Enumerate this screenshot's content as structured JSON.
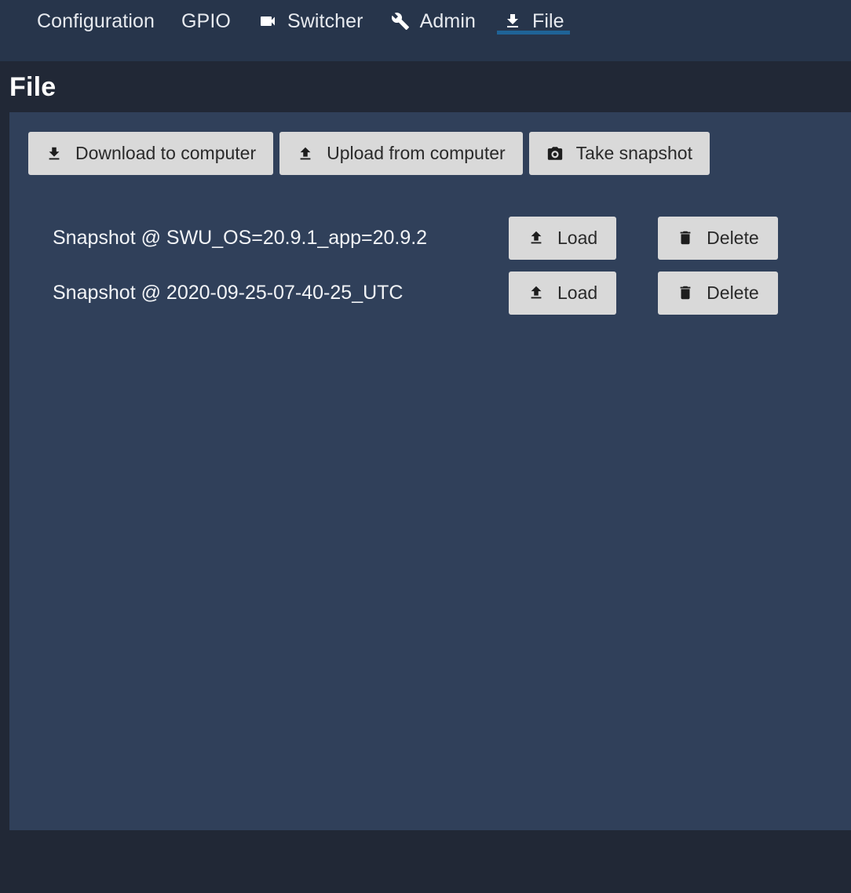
{
  "nav": {
    "tabs": [
      {
        "label": "Configuration",
        "icon": "none",
        "active": false
      },
      {
        "label": "GPIO",
        "icon": "none",
        "active": false
      },
      {
        "label": "Switcher",
        "icon": "videocam-icon",
        "active": false
      },
      {
        "label": "Admin",
        "icon": "wrench-icon",
        "active": false
      },
      {
        "label": "File",
        "icon": "download-icon",
        "active": true
      }
    ],
    "active_indicator_color": "#1f6397"
  },
  "header": {
    "title": "File"
  },
  "toolbar": {
    "buttons": [
      {
        "label": "Download to computer",
        "icon": "download-icon"
      },
      {
        "label": "Upload from computer",
        "icon": "upload-icon"
      },
      {
        "label": "Take snapshot",
        "icon": "camera-icon"
      }
    ]
  },
  "snapshots": {
    "load_label": "Load",
    "delete_label": "Delete",
    "rows": [
      {
        "name": "Snapshot @ SWU_OS=20.9.1_app=20.9.2"
      },
      {
        "name": "Snapshot @ 2020-09-25-07-40-25_UTC"
      }
    ]
  },
  "colors": {
    "navbar_bg": "#27354b",
    "title_bg": "#212836",
    "panel_bg": "#30405a",
    "button_bg": "#d9d9d9",
    "accent": "#1f6397"
  }
}
